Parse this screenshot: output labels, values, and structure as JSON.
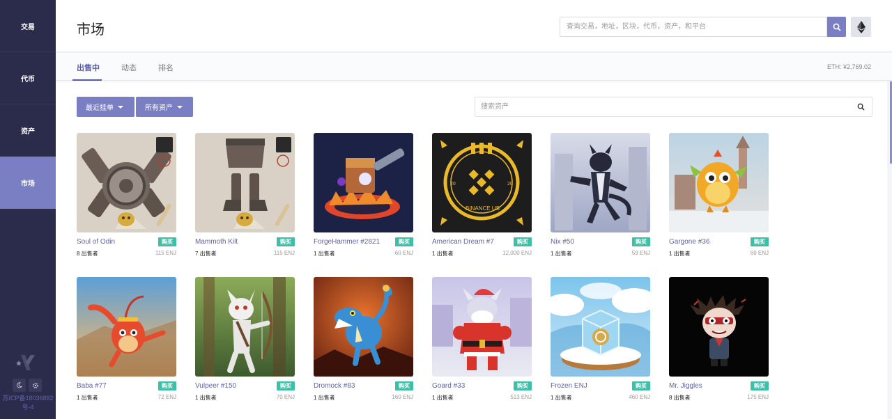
{
  "sidebar": {
    "items": [
      {
        "label": "交易"
      },
      {
        "label": "代币"
      },
      {
        "label": "资产"
      },
      {
        "label": "市场"
      }
    ],
    "icp": "苏ICP备18036882号-4"
  },
  "header": {
    "title": "市场",
    "search_placeholder": "查询交易，地址，区块，代币，资产，和平台"
  },
  "tabs": [
    {
      "label": "出售中"
    },
    {
      "label": "动态"
    },
    {
      "label": "排名"
    }
  ],
  "eth_price": "ETH: ¥2,769.02",
  "filters": {
    "sort_label": "最近挂单",
    "type_label": "所有资产",
    "search_placeholder": "搜索资产"
  },
  "buy_label": "购买",
  "items": [
    {
      "name": "Soul of Odin",
      "sellers": "8 出售者",
      "price": "115 ENJ",
      "art": "armor"
    },
    {
      "name": "Mammoth Kilt",
      "sellers": "7 出售者",
      "price": "115 ENJ",
      "art": "kilt"
    },
    {
      "name": "ForgeHammer #2821",
      "sellers": "1 出售者",
      "price": "60 ENJ",
      "art": "hammer"
    },
    {
      "name": "American Dream #7",
      "sellers": "1 出售者",
      "price": "12,000 ENJ",
      "art": "binance"
    },
    {
      "name": "Nix #50",
      "sellers": "1 出售者",
      "price": "59 ENJ",
      "art": "cat"
    },
    {
      "name": "Gargone #36",
      "sellers": "1 出售者",
      "price": "69 ENJ",
      "art": "dragon"
    },
    {
      "name": "Baba #77",
      "sellers": "1 出售者",
      "price": "72 ENJ",
      "art": "monkey"
    },
    {
      "name": "Vulpeer #150",
      "sellers": "1 出售者",
      "price": "70 ENJ",
      "art": "archer"
    },
    {
      "name": "Dromock #83",
      "sellers": "1 出售者",
      "price": "160 ENJ",
      "art": "dino"
    },
    {
      "name": "Goard #33",
      "sellers": "1 出售者",
      "price": "513 ENJ",
      "art": "santa"
    },
    {
      "name": "Frozen ENJ",
      "sellers": "1 出售者",
      "price": "460 ENJ",
      "art": "ice"
    },
    {
      "name": "Mr. Jiggles",
      "sellers": "8 出售者",
      "price": "175 ENJ",
      "art": "jiggles"
    }
  ],
  "binance_text": "BINANCE US",
  "binance_year_left": "20",
  "binance_year_right": "20",
  "colors": {
    "sidebar_bg": "#2b2b4b",
    "accent": "#7a7fc3",
    "link": "#5e63a8",
    "buy_badge": "#3cc0a8"
  }
}
